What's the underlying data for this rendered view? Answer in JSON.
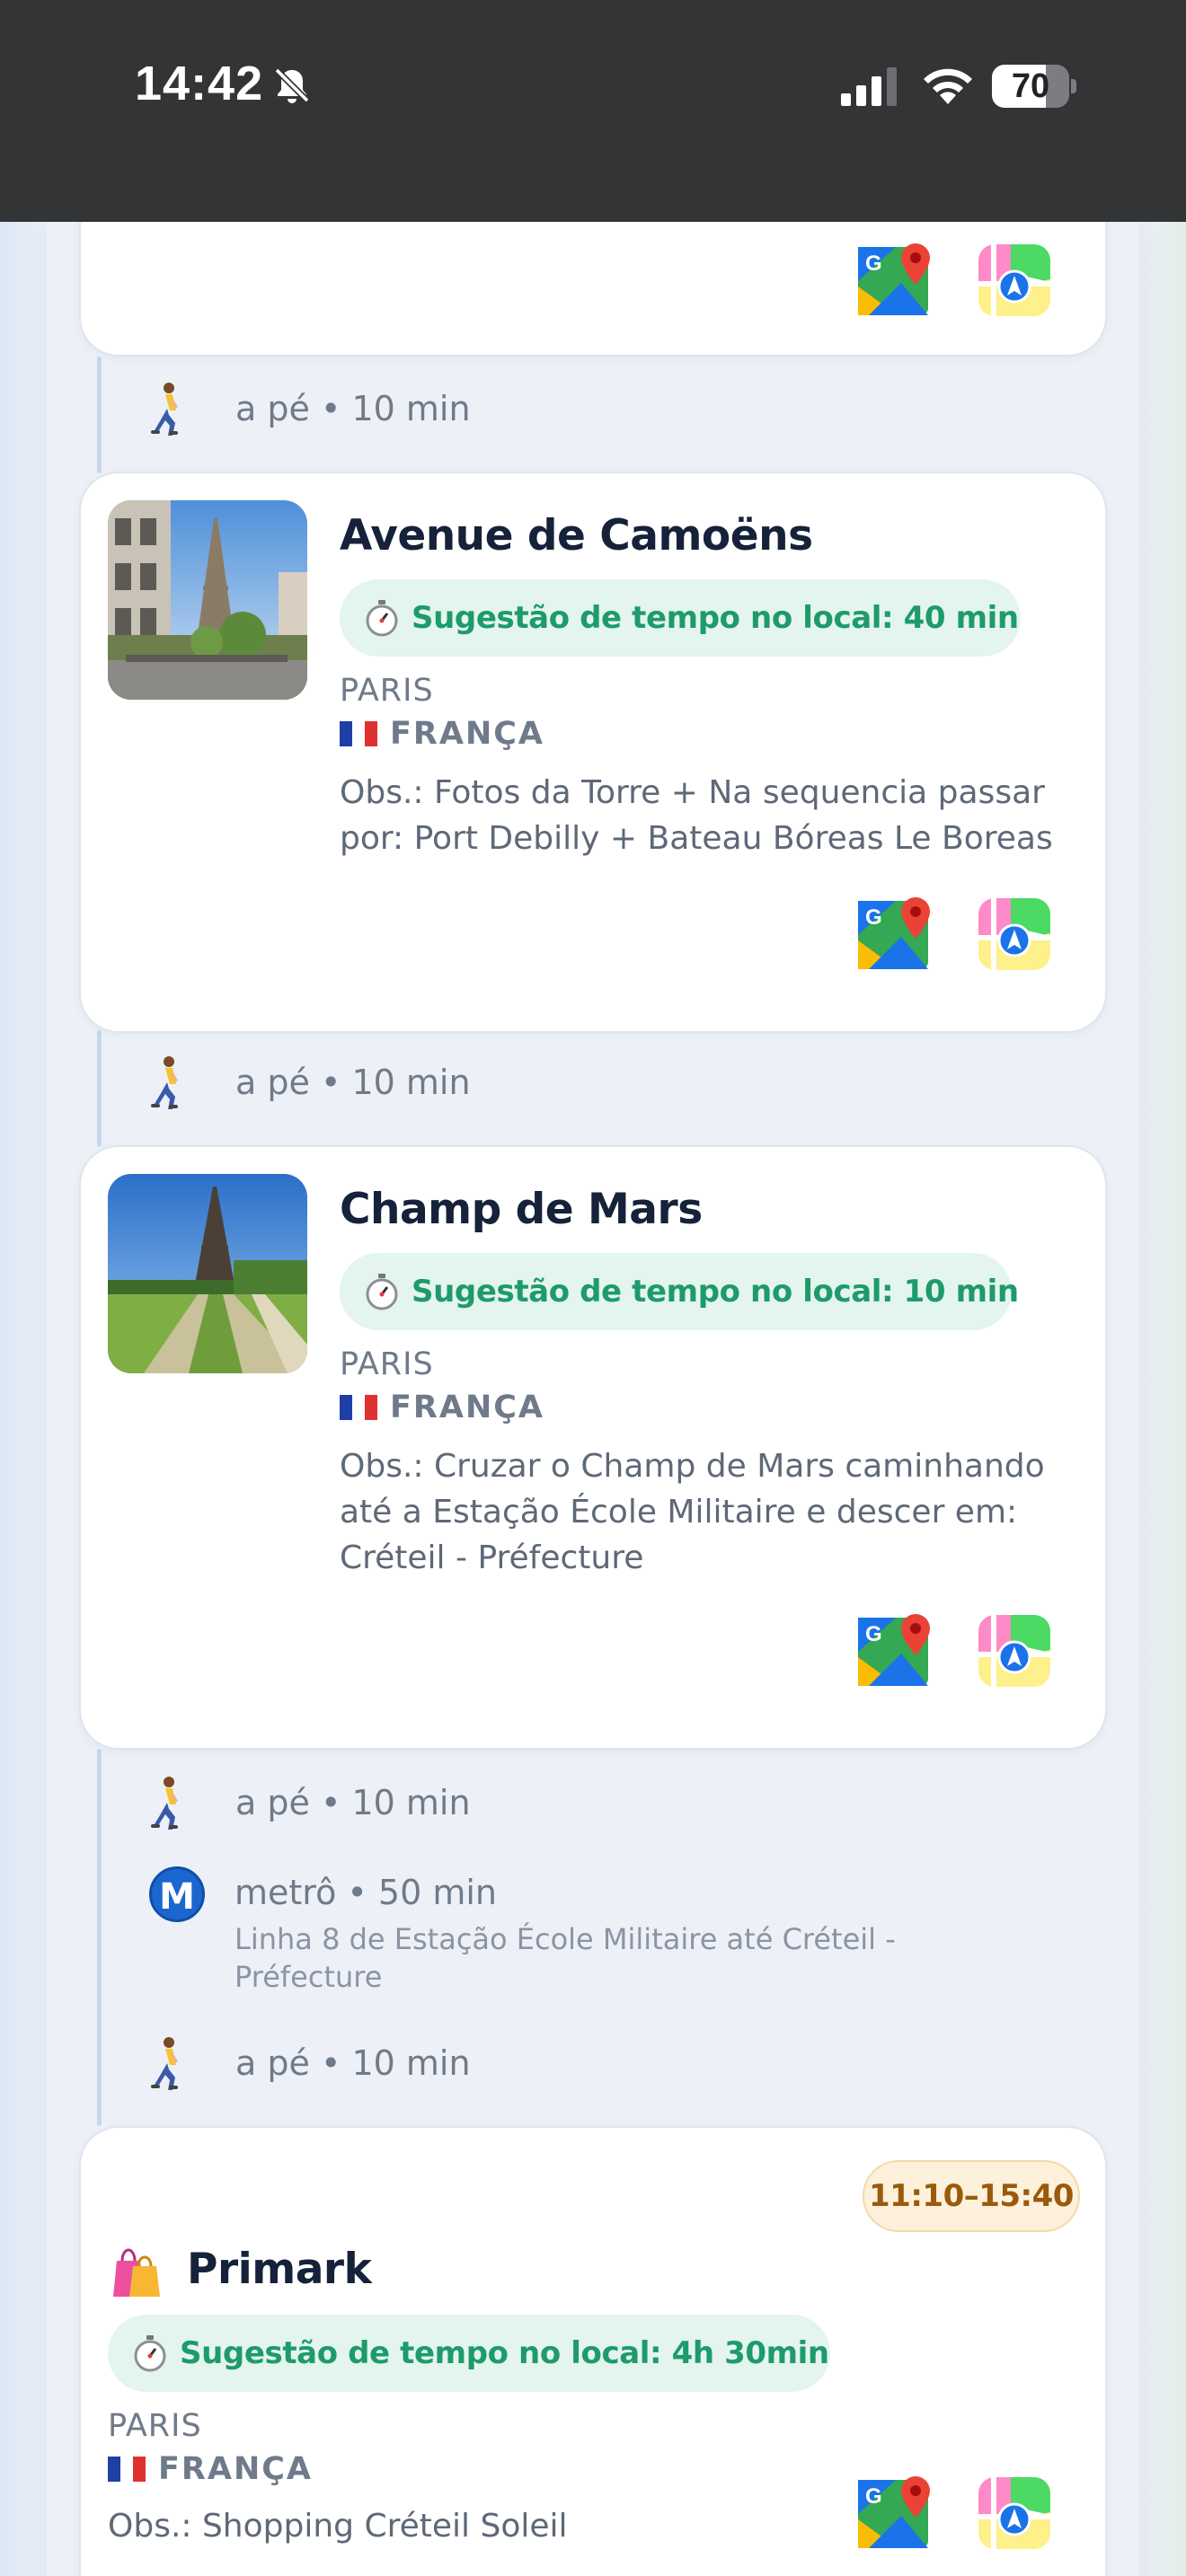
{
  "status_bar": {
    "time": "14:42",
    "battery_level": "70",
    "battery_fraction": 0.7
  },
  "transit_steps": {
    "walk_1": "a pé • 10 min",
    "walk_2": "a pé • 10 min",
    "walk_3": "a pé • 10 min",
    "metro_label": "metrô • 50 min",
    "metro_badge": "M",
    "metro_detail": "Linha 8 de Estação École Militaire até Créteil - Préfecture",
    "walk_4": "a pé • 10 min"
  },
  "places": [
    {
      "title": "Avenue de Camoëns",
      "suggestion": "Sugestão de tempo no local: 40 min",
      "city": "PARIS",
      "country": "FRANÇA",
      "obs": "Obs.: Fotos da Torre + Na sequencia passar por: Port Debilly + Bateau Bóreas Le Boreas"
    },
    {
      "title": "Champ de Mars",
      "suggestion": "Sugestão de tempo no local: 10 min",
      "city": "PARIS",
      "country": "FRANÇA",
      "obs": "Obs.: Cruzar o Champ de Mars caminhando até a Estação École Militaire e descer em: Créteil - Préfecture"
    },
    {
      "title": "Primark",
      "time_range": "11:10–15:40",
      "suggestion": "Sugestão de tempo no local: 4h 30min",
      "city": "PARIS",
      "country": "FRANÇA",
      "obs": "Obs.: Shopping Créteil Soleil"
    }
  ],
  "icons": {
    "google_maps": "google-maps-icon",
    "apple_maps": "apple-maps-icon",
    "walk": "walking-person-icon",
    "clock": "stopwatch-icon",
    "shopping": "shopping-bags-icon",
    "flag": "france-flag-icon"
  },
  "colors": {
    "suggestion_bg": "#e3f5ee",
    "suggestion_text": "#1e9a6b",
    "metro_blue": "#1c66cf",
    "time_badge_bg": "#fdf1dc",
    "time_badge_text": "#9a5a0c"
  }
}
